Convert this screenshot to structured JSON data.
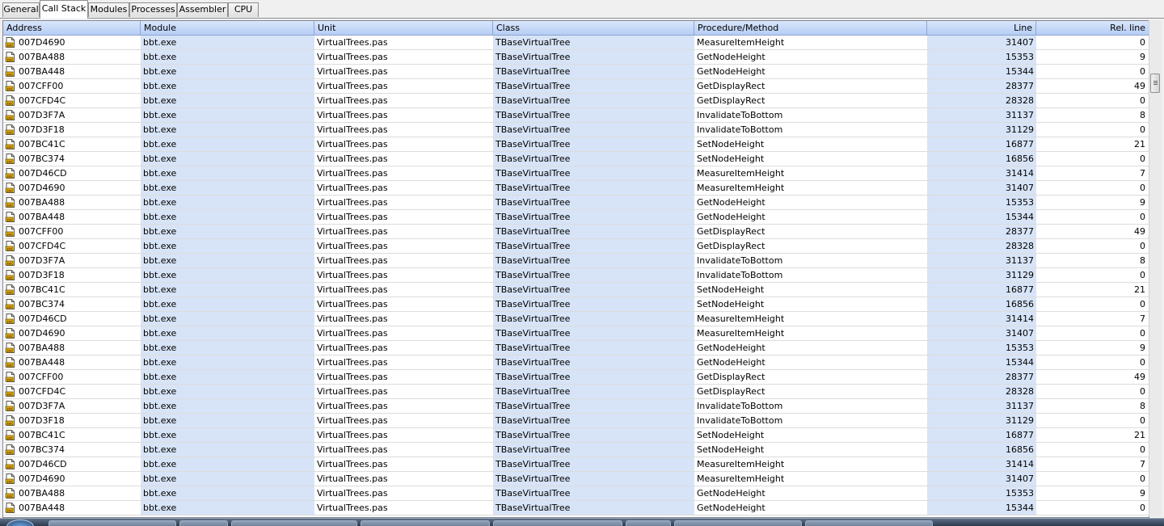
{
  "tabs": [
    {
      "label": "General",
      "active": false
    },
    {
      "label": "Call Stack",
      "active": true
    },
    {
      "label": "Modules",
      "active": false
    },
    {
      "label": "Processes",
      "active": false
    },
    {
      "label": "Assembler",
      "active": false
    },
    {
      "label": "CPU",
      "active": false
    }
  ],
  "grid": {
    "columns": {
      "address": "Address",
      "module": "Module",
      "unit": "Unit",
      "class": "Class",
      "procedure": "Procedure/Method",
      "line": "Line",
      "rel_line": "Rel. line"
    },
    "shaded_column_color": "#d7e4f7",
    "header_color": "#c5d8f8",
    "rows": [
      {
        "address": "007D4690",
        "module": "bbt.exe",
        "unit": "VirtualTrees.pas",
        "class": "TBaseVirtualTree",
        "procedure": "MeasureItemHeight",
        "line": "31407",
        "rel": "0"
      },
      {
        "address": "007BA488",
        "module": "bbt.exe",
        "unit": "VirtualTrees.pas",
        "class": "TBaseVirtualTree",
        "procedure": "GetNodeHeight",
        "line": "15353",
        "rel": "9"
      },
      {
        "address": "007BA448",
        "module": "bbt.exe",
        "unit": "VirtualTrees.pas",
        "class": "TBaseVirtualTree",
        "procedure": "GetNodeHeight",
        "line": "15344",
        "rel": "0"
      },
      {
        "address": "007CFF00",
        "module": "bbt.exe",
        "unit": "VirtualTrees.pas",
        "class": "TBaseVirtualTree",
        "procedure": "GetDisplayRect",
        "line": "28377",
        "rel": "49"
      },
      {
        "address": "007CFD4C",
        "module": "bbt.exe",
        "unit": "VirtualTrees.pas",
        "class": "TBaseVirtualTree",
        "procedure": "GetDisplayRect",
        "line": "28328",
        "rel": "0"
      },
      {
        "address": "007D3F7A",
        "module": "bbt.exe",
        "unit": "VirtualTrees.pas",
        "class": "TBaseVirtualTree",
        "procedure": "InvalidateToBottom",
        "line": "31137",
        "rel": "8"
      },
      {
        "address": "007D3F18",
        "module": "bbt.exe",
        "unit": "VirtualTrees.pas",
        "class": "TBaseVirtualTree",
        "procedure": "InvalidateToBottom",
        "line": "31129",
        "rel": "0"
      },
      {
        "address": "007BC41C",
        "module": "bbt.exe",
        "unit": "VirtualTrees.pas",
        "class": "TBaseVirtualTree",
        "procedure": "SetNodeHeight",
        "line": "16877",
        "rel": "21"
      },
      {
        "address": "007BC374",
        "module": "bbt.exe",
        "unit": "VirtualTrees.pas",
        "class": "TBaseVirtualTree",
        "procedure": "SetNodeHeight",
        "line": "16856",
        "rel": "0"
      },
      {
        "address": "007D46CD",
        "module": "bbt.exe",
        "unit": "VirtualTrees.pas",
        "class": "TBaseVirtualTree",
        "procedure": "MeasureItemHeight",
        "line": "31414",
        "rel": "7"
      },
      {
        "address": "007D4690",
        "module": "bbt.exe",
        "unit": "VirtualTrees.pas",
        "class": "TBaseVirtualTree",
        "procedure": "MeasureItemHeight",
        "line": "31407",
        "rel": "0"
      },
      {
        "address": "007BA488",
        "module": "bbt.exe",
        "unit": "VirtualTrees.pas",
        "class": "TBaseVirtualTree",
        "procedure": "GetNodeHeight",
        "line": "15353",
        "rel": "9"
      },
      {
        "address": "007BA448",
        "module": "bbt.exe",
        "unit": "VirtualTrees.pas",
        "class": "TBaseVirtualTree",
        "procedure": "GetNodeHeight",
        "line": "15344",
        "rel": "0"
      },
      {
        "address": "007CFF00",
        "module": "bbt.exe",
        "unit": "VirtualTrees.pas",
        "class": "TBaseVirtualTree",
        "procedure": "GetDisplayRect",
        "line": "28377",
        "rel": "49"
      },
      {
        "address": "007CFD4C",
        "module": "bbt.exe",
        "unit": "VirtualTrees.pas",
        "class": "TBaseVirtualTree",
        "procedure": "GetDisplayRect",
        "line": "28328",
        "rel": "0"
      },
      {
        "address": "007D3F7A",
        "module": "bbt.exe",
        "unit": "VirtualTrees.pas",
        "class": "TBaseVirtualTree",
        "procedure": "InvalidateToBottom",
        "line": "31137",
        "rel": "8"
      },
      {
        "address": "007D3F18",
        "module": "bbt.exe",
        "unit": "VirtualTrees.pas",
        "class": "TBaseVirtualTree",
        "procedure": "InvalidateToBottom",
        "line": "31129",
        "rel": "0"
      },
      {
        "address": "007BC41C",
        "module": "bbt.exe",
        "unit": "VirtualTrees.pas",
        "class": "TBaseVirtualTree",
        "procedure": "SetNodeHeight",
        "line": "16877",
        "rel": "21"
      },
      {
        "address": "007BC374",
        "module": "bbt.exe",
        "unit": "VirtualTrees.pas",
        "class": "TBaseVirtualTree",
        "procedure": "SetNodeHeight",
        "line": "16856",
        "rel": "0"
      },
      {
        "address": "007D46CD",
        "module": "bbt.exe",
        "unit": "VirtualTrees.pas",
        "class": "TBaseVirtualTree",
        "procedure": "MeasureItemHeight",
        "line": "31414",
        "rel": "7"
      },
      {
        "address": "007D4690",
        "module": "bbt.exe",
        "unit": "VirtualTrees.pas",
        "class": "TBaseVirtualTree",
        "procedure": "MeasureItemHeight",
        "line": "31407",
        "rel": "0"
      },
      {
        "address": "007BA488",
        "module": "bbt.exe",
        "unit": "VirtualTrees.pas",
        "class": "TBaseVirtualTree",
        "procedure": "GetNodeHeight",
        "line": "15353",
        "rel": "9"
      },
      {
        "address": "007BA448",
        "module": "bbt.exe",
        "unit": "VirtualTrees.pas",
        "class": "TBaseVirtualTree",
        "procedure": "GetNodeHeight",
        "line": "15344",
        "rel": "0"
      },
      {
        "address": "007CFF00",
        "module": "bbt.exe",
        "unit": "VirtualTrees.pas",
        "class": "TBaseVirtualTree",
        "procedure": "GetDisplayRect",
        "line": "28377",
        "rel": "49"
      },
      {
        "address": "007CFD4C",
        "module": "bbt.exe",
        "unit": "VirtualTrees.pas",
        "class": "TBaseVirtualTree",
        "procedure": "GetDisplayRect",
        "line": "28328",
        "rel": "0"
      },
      {
        "address": "007D3F7A",
        "module": "bbt.exe",
        "unit": "VirtualTrees.pas",
        "class": "TBaseVirtualTree",
        "procedure": "InvalidateToBottom",
        "line": "31137",
        "rel": "8"
      },
      {
        "address": "007D3F18",
        "module": "bbt.exe",
        "unit": "VirtualTrees.pas",
        "class": "TBaseVirtualTree",
        "procedure": "InvalidateToBottom",
        "line": "31129",
        "rel": "0"
      },
      {
        "address": "007BC41C",
        "module": "bbt.exe",
        "unit": "VirtualTrees.pas",
        "class": "TBaseVirtualTree",
        "procedure": "SetNodeHeight",
        "line": "16877",
        "rel": "21"
      },
      {
        "address": "007BC374",
        "module": "bbt.exe",
        "unit": "VirtualTrees.pas",
        "class": "TBaseVirtualTree",
        "procedure": "SetNodeHeight",
        "line": "16856",
        "rel": "0"
      },
      {
        "address": "007D46CD",
        "module": "bbt.exe",
        "unit": "VirtualTrees.pas",
        "class": "TBaseVirtualTree",
        "procedure": "MeasureItemHeight",
        "line": "31414",
        "rel": "7"
      },
      {
        "address": "007D4690",
        "module": "bbt.exe",
        "unit": "VirtualTrees.pas",
        "class": "TBaseVirtualTree",
        "procedure": "MeasureItemHeight",
        "line": "31407",
        "rel": "0"
      },
      {
        "address": "007BA488",
        "module": "bbt.exe",
        "unit": "VirtualTrees.pas",
        "class": "TBaseVirtualTree",
        "procedure": "GetNodeHeight",
        "line": "15353",
        "rel": "9"
      },
      {
        "address": "007BA448",
        "module": "bbt.exe",
        "unit": "VirtualTrees.pas",
        "class": "TBaseVirtualTree",
        "procedure": "GetNodeHeight",
        "line": "15344",
        "rel": "0"
      }
    ]
  },
  "row_icon": "source-file-icon",
  "scrollbar_icon": "scroll-thumb-grip-icon"
}
